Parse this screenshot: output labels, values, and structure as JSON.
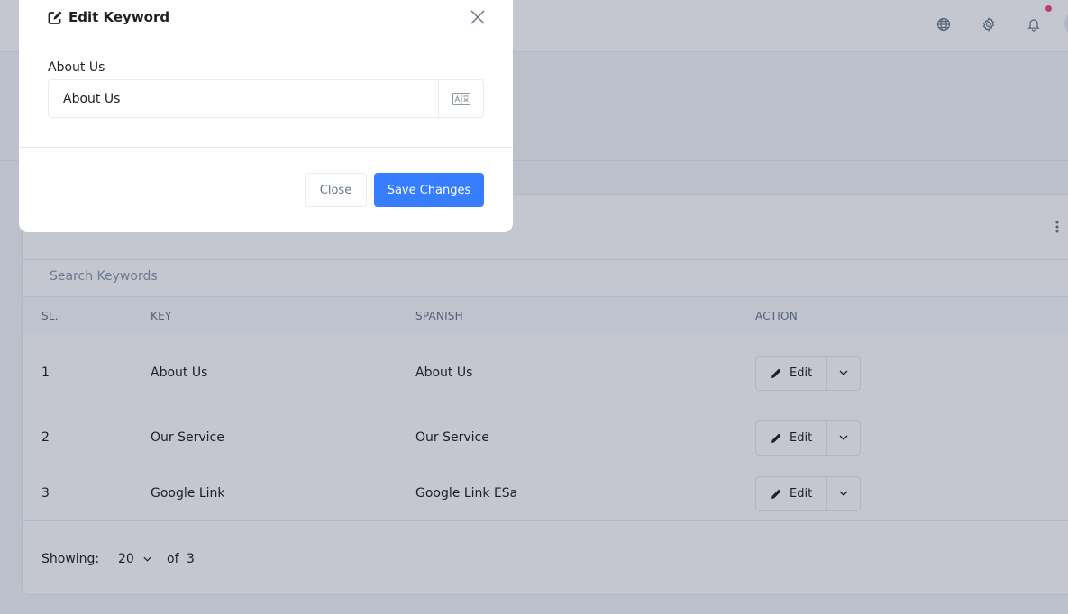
{
  "modal": {
    "title": "Edit Keyword",
    "field_label": "About Us",
    "field_value": "About Us",
    "close_label": "Close",
    "save_label": "Save Changes"
  },
  "search": {
    "placeholder": "Search Keywords"
  },
  "table": {
    "headers": [
      "SL.",
      "KEY",
      "SPANISH",
      "ACTION"
    ],
    "rows": [
      {
        "sl": "1",
        "key": "About Us",
        "spanish": "About Us",
        "action": "Edit"
      },
      {
        "sl": "2",
        "key": "Our Service",
        "spanish": "Our Service",
        "action": "Edit"
      },
      {
        "sl": "3",
        "key": "Google Link",
        "spanish": "Google Link ESa",
        "action": "Edit"
      }
    ]
  },
  "footer": {
    "showing_label": "Showing:",
    "per_page": "20",
    "of_label": "of",
    "total": "3"
  },
  "colors": {
    "primary": "#377dff",
    "notification_dot": "#ed4c78"
  },
  "icons": [
    "edit-square-icon",
    "close-icon",
    "translate-icon",
    "globe-icon",
    "gear-icon",
    "bell-icon",
    "pencil-icon",
    "chevron-down-icon",
    "kebab-icon"
  ]
}
